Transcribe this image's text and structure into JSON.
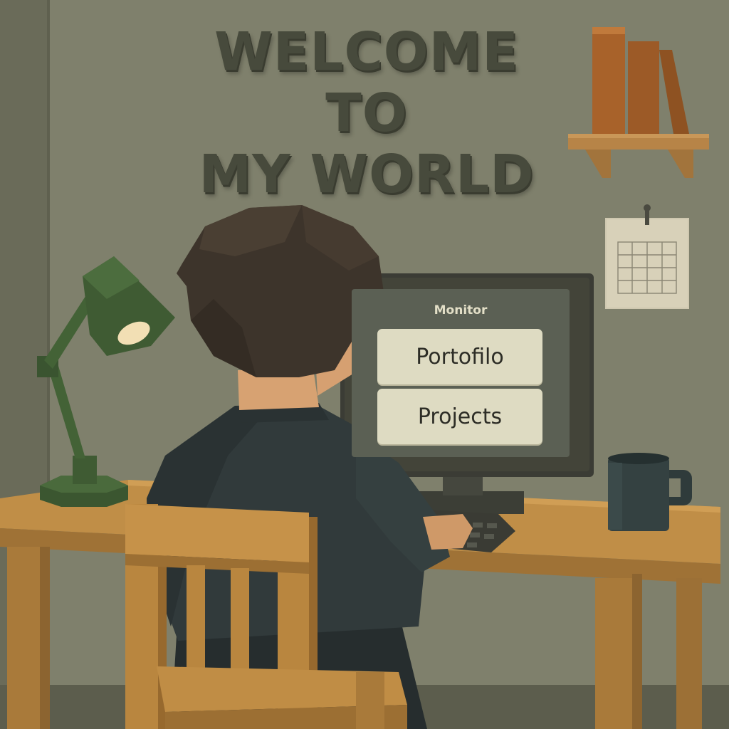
{
  "headline": {
    "lines": [
      "WELCOME",
      "TO",
      "MY WORLD"
    ]
  },
  "monitor": {
    "title": "Monitor",
    "buttons": [
      {
        "label": "Portofilo"
      },
      {
        "label": "Projects"
      }
    ]
  },
  "colors": {
    "wall": "#7d7e6b",
    "headline": "#474a3c",
    "desk": "#b07f3a",
    "lamp": "#3f5b33",
    "shirt": "#30393a",
    "screen": "#5b6054",
    "screen_button": "#dedbc2"
  },
  "icons": [
    "desk-lamp-icon",
    "coffee-mug-icon",
    "calendar-icon",
    "bookshelf-icon"
  ]
}
